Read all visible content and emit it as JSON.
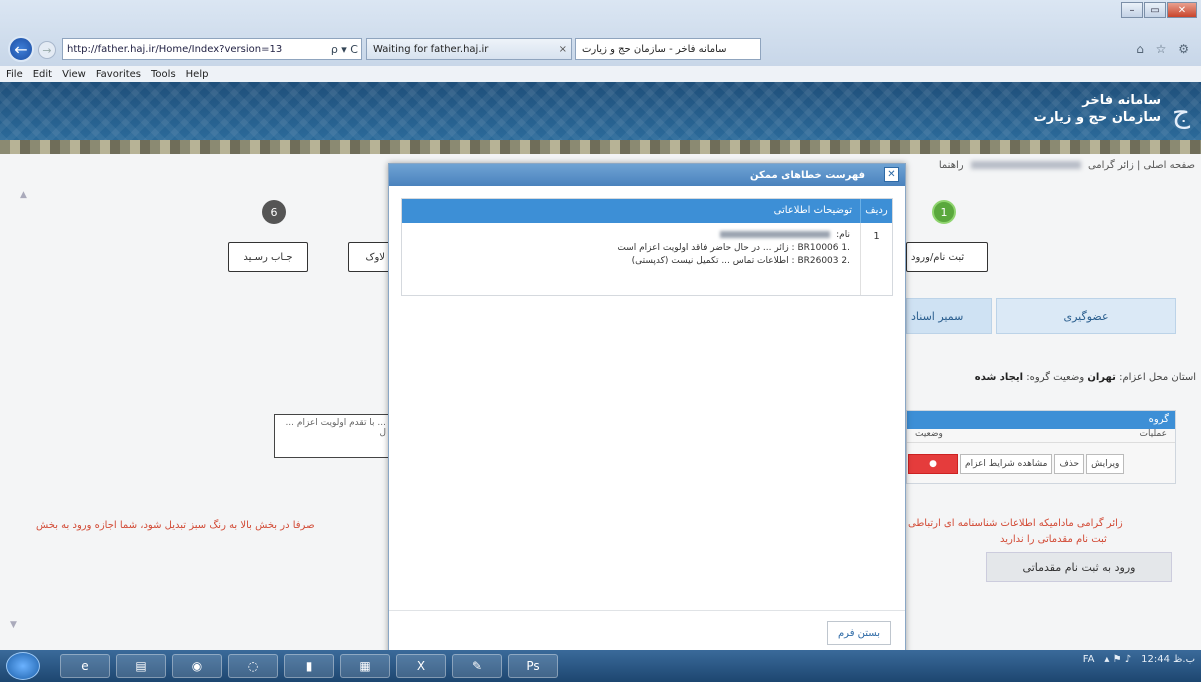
{
  "browser": {
    "address": "http://father.haj.ir/Home/Index?version=13",
    "address_tools": "ρ ▾ C",
    "tabs": [
      {
        "label": "Waiting for father.haj.ir"
      },
      {
        "label": "سامانه فاخر - سازمان حج و زیارت"
      }
    ],
    "menu": [
      "File",
      "Edit",
      "View",
      "Favorites",
      "Tools",
      "Help"
    ],
    "win_controls": [
      "–",
      "▭",
      "✕"
    ]
  },
  "site": {
    "title_line1": "سامانه فاخر",
    "title_line2": "سازمان حج و زیارت",
    "breadcrumb_home": "صفحه اصلی",
    "breadcrumb_user_prefix": "زائر گرامی",
    "breadcrumb_suffix": "راهنما"
  },
  "steps": {
    "step6_number": "6",
    "step6_label": "جـاب رسـید",
    "partial_label": "لاوک",
    "step1_number": "1",
    "step1_label": "ثبت نام/ورود"
  },
  "tabs": {
    "tab_a": "سمیر اسناد",
    "tab_b": "عضوگیری"
  },
  "group_info": {
    "text_prefix": "استان محل اعزام:",
    "province": "تهران",
    "status_prefix": "وضعیت گروه:",
    "status": "ایجاد شده"
  },
  "group_table": {
    "header": "گروه",
    "col_actions": "عملیات",
    "col_status": "وضعیت",
    "actions": [
      "ویرایش",
      "حذف",
      "مشاهده شرایط اعزام"
    ]
  },
  "note_box": "... با تقدم اولویت اعزام ... ل",
  "red_notes": {
    "left": "صرفا در بخش بالا به رنگ سبز تبدیل شود، شما اجازه ورود به بخش",
    "right_1": "زائر گرامی مادامیکه اطلاعات شناسنامه ای ارتباطی",
    "right_2": "ثبت نام مقدماتی را ندارید"
  },
  "pre_reg_button": "ورود به ثبت نام مقدماتی",
  "modal": {
    "title": "فهرست خطاهای ممکن",
    "close": "✕",
    "col_row": "ردیف",
    "col_desc": "توضیحات اطلاعاتی",
    "row_number": "1",
    "line_prefix": "نام:",
    "error1_code": "BR10006",
    "error1_text": ": زائر ... در حال حاضر فاقد اولویت اعزام است",
    "error1_num": ".1",
    "error2_code": "BR26003",
    "error2_text": ": اطلاعات تماس ... تکمیل نیست (کدپستی)",
    "error2_num": ".2",
    "ok_button": "بستن فرم"
  },
  "taskbar": {
    "apps": [
      "e",
      "▤",
      "◉",
      "◌",
      "▮",
      "▦",
      "X",
      "✎",
      "Ps"
    ],
    "tray_lang": "FA",
    "clock": "12:44 ب.ظ"
  }
}
